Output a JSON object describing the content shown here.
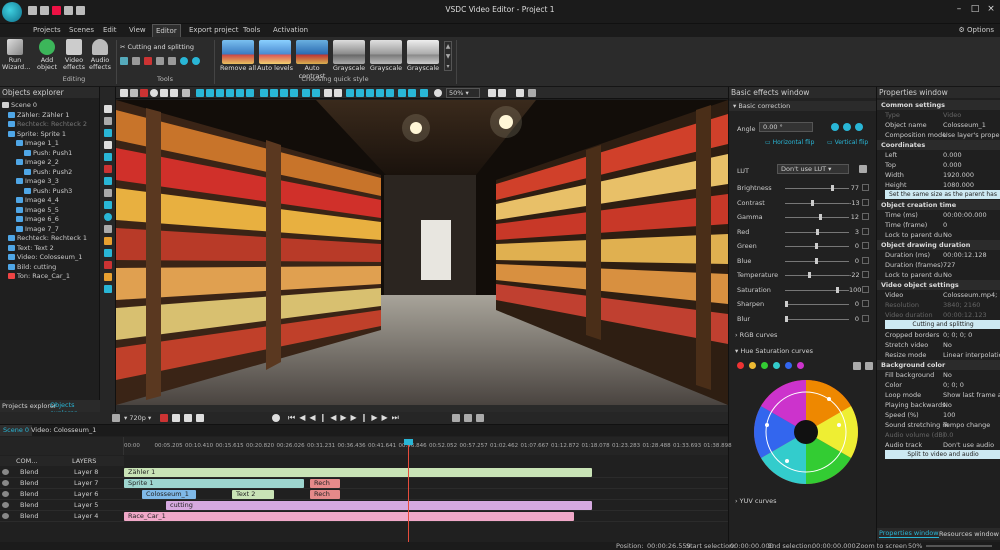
{
  "app": {
    "title": "VSDC Video Editor - Project 1",
    "options_label": "Options"
  },
  "menu": [
    "Projects",
    "Scenes",
    "Edit",
    "View",
    "Editor",
    "Export project",
    "Tools",
    "Activation"
  ],
  "ribbon": {
    "run_wizard": "Run Wizard...",
    "add_object": "Add object",
    "video_effects": "Video effects",
    "audio_effects": "Audio effects",
    "editing_group": "Editing",
    "cutting_splitting": "Cutting and splitting",
    "tools_group": "Tools",
    "quick_styles": [
      "Remove all",
      "Auto levels",
      "Auto contrast",
      "Grayscale",
      "Grayscale",
      "Grayscale"
    ],
    "quick_style_group": "Choosing quick style"
  },
  "objects_explorer": {
    "title": "Objects explorer",
    "items": [
      {
        "label": "Scene 0",
        "color": "#cfcfcf"
      },
      {
        "label": "Zähler: Zähler 1",
        "color": "#4fa6e6"
      },
      {
        "label": "Rechteck: Rechteck 2",
        "color": "#4fa6e6",
        "dim": true
      },
      {
        "label": "Sprite: Sprite 1",
        "color": "#4fa6e6"
      },
      {
        "label": "Image 1_1",
        "color": "#4fa6e6"
      },
      {
        "label": "Push: Push1",
        "color": "#4fa6e6"
      },
      {
        "label": "Image 2_2",
        "color": "#4fa6e6"
      },
      {
        "label": "Push: Push2",
        "color": "#4fa6e6"
      },
      {
        "label": "Image 3_3",
        "color": "#4fa6e6"
      },
      {
        "label": "Push: Push3",
        "color": "#4fa6e6"
      },
      {
        "label": "Image 4_4",
        "color": "#4fa6e6"
      },
      {
        "label": "Image 5_5",
        "color": "#4fa6e6"
      },
      {
        "label": "Image 6_6",
        "color": "#4fa6e6"
      },
      {
        "label": "Image 7_7",
        "color": "#4fa6e6"
      },
      {
        "label": "Rechteck: Rechteck 1",
        "color": "#4fa6e6"
      },
      {
        "label": "Text: Text 2",
        "color": "#4fa6e6"
      },
      {
        "label": "Video: Colosseum_1",
        "color": "#4fa6e6"
      },
      {
        "label": "Bild: cutting",
        "color": "#4fa6e6"
      },
      {
        "label": "Ton: Race_Car_1",
        "color": "#e44"
      }
    ],
    "tab_projects": "Projects explorer",
    "tab_objects": "Objects explorer"
  },
  "preview_toolbar": {
    "zoom": "50%"
  },
  "playback": {
    "resolution": "720p"
  },
  "effects": {
    "title": "Basic effects window",
    "section": "Basic correction",
    "angle_label": "Angle",
    "angle_value": "0.00 °",
    "horizontal_flip": "Horizontal flip",
    "vertical_flip": "Vertical flip",
    "lut_label": "LUT",
    "lut_value": "Don't use LUT",
    "adjustments": [
      {
        "label": "Brightness",
        "value": "77",
        "level": 0.77
      },
      {
        "label": "Contrast",
        "value": "-13",
        "level": 0.44
      },
      {
        "label": "Gamma",
        "value": "12",
        "level": 0.56
      },
      {
        "label": "Red",
        "value": "3",
        "level": 0.52
      },
      {
        "label": "Green",
        "value": "0",
        "level": 0.5
      },
      {
        "label": "Blue",
        "value": "0",
        "level": 0.5
      },
      {
        "label": "Temperature",
        "value": "-22",
        "level": 0.39
      },
      {
        "label": "Saturation",
        "value": "100",
        "level": 0.85
      },
      {
        "label": "Sharpen",
        "value": "0",
        "level": 0.0
      },
      {
        "label": "Blur",
        "value": "0",
        "level": 0.0
      }
    ],
    "rgb_curves": "RGB curves",
    "hue_saturation": "Hue Saturation curves",
    "yuv_curves": "YUV curves"
  },
  "properties": {
    "title": "Properties window",
    "rows": [
      {
        "type": "hdr",
        "k": "Common settings"
      },
      {
        "k": "Type",
        "v": "Video",
        "dim": true
      },
      {
        "k": "Object name",
        "v": "Colosseum_1"
      },
      {
        "k": "Composition mode",
        "v": "Use layer's properties"
      },
      {
        "type": "hdr",
        "k": "Coordinates"
      },
      {
        "k": "Left",
        "v": "0.000"
      },
      {
        "k": "Top",
        "v": "0.000"
      },
      {
        "k": "Width",
        "v": "1920.000"
      },
      {
        "k": "Height",
        "v": "1080.000"
      },
      {
        "type": "btn",
        "k": "Set the same size as the parent has"
      },
      {
        "type": "hdr",
        "k": "Object creation time"
      },
      {
        "k": "Time (ms)",
        "v": "00:00:00.000"
      },
      {
        "k": "Time (frame)",
        "v": "0"
      },
      {
        "k": "Lock to parent du",
        "v": "No"
      },
      {
        "type": "hdr",
        "k": "Object drawing duration"
      },
      {
        "k": "Duration (ms)",
        "v": "00:00:12.128"
      },
      {
        "k": "Duration (frames)",
        "v": "727"
      },
      {
        "k": "Lock to parent du",
        "v": "No"
      },
      {
        "type": "hdr",
        "k": "Video object settings"
      },
      {
        "k": "Video",
        "v": "Colosseum.mp4; ID"
      },
      {
        "k": "Resolution",
        "v": "3840; 2160",
        "dim": true
      },
      {
        "k": "Video duration",
        "v": "00:00:12.123",
        "dim": true
      },
      {
        "type": "btn",
        "k": "Cutting and splitting"
      },
      {
        "k": "Cropped borders",
        "v": "0; 0; 0; 0"
      },
      {
        "k": "Stretch video",
        "v": "No"
      },
      {
        "k": "Resize mode",
        "v": "Linear interpolation"
      },
      {
        "type": "hdr",
        "k": "Background color"
      },
      {
        "k": "Fill background",
        "v": "No"
      },
      {
        "k": "Color",
        "v": "0; 0; 0"
      },
      {
        "k": "Loop mode",
        "v": "Show last frame at th"
      },
      {
        "k": "Playing backwards",
        "v": "No"
      },
      {
        "k": "Speed (%)",
        "v": "100"
      },
      {
        "k": "Sound stretching m",
        "v": "Tempo change"
      },
      {
        "k": "Audio volume (dB)",
        "v": "0.0",
        "dim": true
      },
      {
        "k": "Audio track",
        "v": "Don't use audio"
      },
      {
        "type": "btn",
        "k": "Split to video and audio"
      }
    ],
    "tab_properties": "Properties window",
    "tab_resources": "Resources window"
  },
  "timeline": {
    "scene_tab": "Scene 0",
    "object_tab": "Video: Colosseum_1",
    "com_label": "COM...",
    "layers_label": "LAYERS",
    "ticks": [
      "00:00",
      "00:05.205",
      "00:10.410",
      "00:15.615",
      "00:20.820",
      "00:26.026",
      "00:31.231",
      "00:36.436",
      "00:41.641",
      "00:46.846",
      "00:52.052",
      "00:57.257",
      "01:02.462",
      "01:07.667",
      "01:12.872",
      "01:18.078",
      "01:23.283",
      "01:28.488",
      "01:33.693",
      "01:38.898"
    ],
    "tracks": [
      {
        "blend": "Blend",
        "layer": "Layer 8",
        "clips": [
          {
            "label": "Zähler 1",
            "start": 0.0,
            "end": 0.78,
            "color": "#c9e3b6"
          }
        ]
      },
      {
        "blend": "Blend",
        "layer": "Layer 7",
        "clips": [
          {
            "label": "Sprite 1",
            "start": 0.0,
            "end": 0.3,
            "color": "#9ed6d0"
          },
          {
            "label": "Rech",
            "start": 0.31,
            "end": 0.36,
            "color": "#e58a8a"
          }
        ]
      },
      {
        "blend": "Blend",
        "layer": "Layer 6",
        "clips": [
          {
            "label": "Colosseum_1",
            "start": 0.03,
            "end": 0.12,
            "color": "#7fb9e8"
          },
          {
            "label": "Text 2",
            "start": 0.18,
            "end": 0.25,
            "color": "#c9e3b6"
          },
          {
            "label": "Rech",
            "start": 0.31,
            "end": 0.36,
            "color": "#e58a8a"
          }
        ]
      },
      {
        "blend": "Blend",
        "layer": "Layer 5",
        "clips": [
          {
            "label": "cutting",
            "start": 0.07,
            "end": 0.78,
            "color": "#d6a9e0"
          }
        ]
      },
      {
        "blend": "Blend",
        "layer": "Layer 4",
        "clips": [
          {
            "label": "Race_Car_1",
            "start": 0.0,
            "end": 0.75,
            "color": "#f0a8c8"
          }
        ]
      }
    ]
  },
  "status": {
    "position_label": "Position:",
    "position": "00:00:26.559",
    "start_sel_label": "Start selection:",
    "start_sel": "00:00:00.000",
    "end_sel_label": "End selection:",
    "end_sel": "00:00:00.000",
    "zoom_label": "Zoom to screen",
    "zoom": "50%"
  },
  "colors": {
    "accent": "#29b6d6",
    "panel": "#1f1f1f",
    "playhead": "#e74c3c"
  }
}
